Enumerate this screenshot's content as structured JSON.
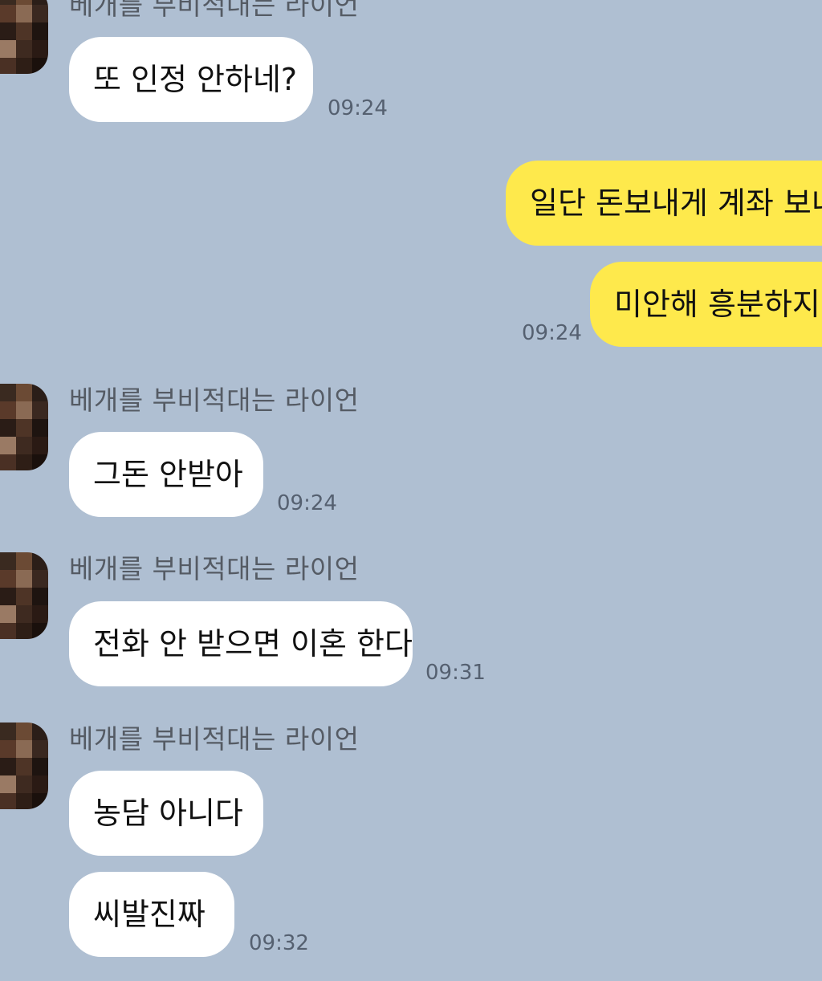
{
  "chat": {
    "sender_name": "베개를 부비적대는 라이언",
    "messages": [
      {
        "text": "또 인정 안하네?",
        "time": "09:24"
      },
      {
        "text": "일단 돈보내게 계좌 보내"
      },
      {
        "text": "미안해 흥분하지마",
        "time": "09:24"
      },
      {
        "text": "그돈 안받아",
        "time": "09:24"
      },
      {
        "text": "전화 안 받으면 이혼 한다",
        "time": "09:31"
      },
      {
        "text": "농담 아니다"
      },
      {
        "text": "씨발진짜",
        "time": "09:32"
      }
    ]
  },
  "colors": {
    "background": "#afbfd2",
    "incoming_bubble": "#ffffff",
    "outgoing_bubble": "#fee94c",
    "timestamp": "#556070",
    "sender_name": "#555b64"
  }
}
